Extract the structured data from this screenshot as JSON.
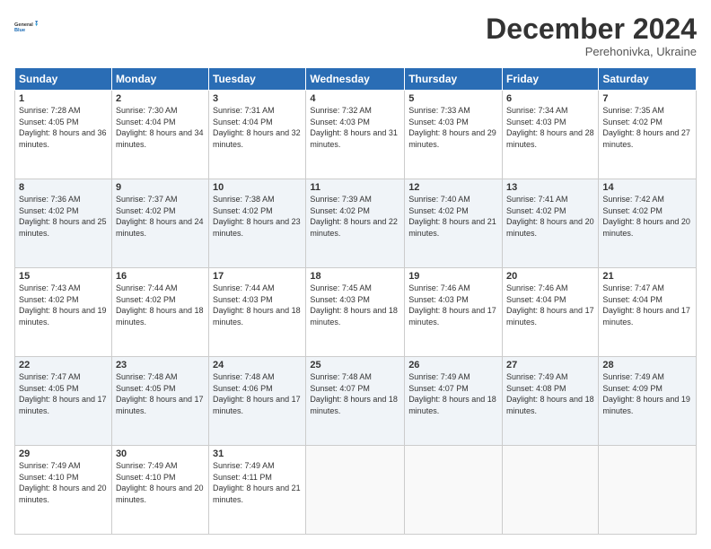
{
  "logo": {
    "line1": "General",
    "line2": "Blue"
  },
  "header": {
    "month": "December 2024",
    "location": "Perehonivka, Ukraine"
  },
  "weekdays": [
    "Sunday",
    "Monday",
    "Tuesday",
    "Wednesday",
    "Thursday",
    "Friday",
    "Saturday"
  ],
  "weeks": [
    [
      {
        "day": "1",
        "sunrise": "7:28 AM",
        "sunset": "4:05 PM",
        "daylight": "8 hours and 36 minutes."
      },
      {
        "day": "2",
        "sunrise": "7:30 AM",
        "sunset": "4:04 PM",
        "daylight": "8 hours and 34 minutes."
      },
      {
        "day": "3",
        "sunrise": "7:31 AM",
        "sunset": "4:04 PM",
        "daylight": "8 hours and 32 minutes."
      },
      {
        "day": "4",
        "sunrise": "7:32 AM",
        "sunset": "4:03 PM",
        "daylight": "8 hours and 31 minutes."
      },
      {
        "day": "5",
        "sunrise": "7:33 AM",
        "sunset": "4:03 PM",
        "daylight": "8 hours and 29 minutes."
      },
      {
        "day": "6",
        "sunrise": "7:34 AM",
        "sunset": "4:03 PM",
        "daylight": "8 hours and 28 minutes."
      },
      {
        "day": "7",
        "sunrise": "7:35 AM",
        "sunset": "4:02 PM",
        "daylight": "8 hours and 27 minutes."
      }
    ],
    [
      {
        "day": "8",
        "sunrise": "7:36 AM",
        "sunset": "4:02 PM",
        "daylight": "8 hours and 25 minutes."
      },
      {
        "day": "9",
        "sunrise": "7:37 AM",
        "sunset": "4:02 PM",
        "daylight": "8 hours and 24 minutes."
      },
      {
        "day": "10",
        "sunrise": "7:38 AM",
        "sunset": "4:02 PM",
        "daylight": "8 hours and 23 minutes."
      },
      {
        "day": "11",
        "sunrise": "7:39 AM",
        "sunset": "4:02 PM",
        "daylight": "8 hours and 22 minutes."
      },
      {
        "day": "12",
        "sunrise": "7:40 AM",
        "sunset": "4:02 PM",
        "daylight": "8 hours and 21 minutes."
      },
      {
        "day": "13",
        "sunrise": "7:41 AM",
        "sunset": "4:02 PM",
        "daylight": "8 hours and 20 minutes."
      },
      {
        "day": "14",
        "sunrise": "7:42 AM",
        "sunset": "4:02 PM",
        "daylight": "8 hours and 20 minutes."
      }
    ],
    [
      {
        "day": "15",
        "sunrise": "7:43 AM",
        "sunset": "4:02 PM",
        "daylight": "8 hours and 19 minutes."
      },
      {
        "day": "16",
        "sunrise": "7:44 AM",
        "sunset": "4:02 PM",
        "daylight": "8 hours and 18 minutes."
      },
      {
        "day": "17",
        "sunrise": "7:44 AM",
        "sunset": "4:03 PM",
        "daylight": "8 hours and 18 minutes."
      },
      {
        "day": "18",
        "sunrise": "7:45 AM",
        "sunset": "4:03 PM",
        "daylight": "8 hours and 18 minutes."
      },
      {
        "day": "19",
        "sunrise": "7:46 AM",
        "sunset": "4:03 PM",
        "daylight": "8 hours and 17 minutes."
      },
      {
        "day": "20",
        "sunrise": "7:46 AM",
        "sunset": "4:04 PM",
        "daylight": "8 hours and 17 minutes."
      },
      {
        "day": "21",
        "sunrise": "7:47 AM",
        "sunset": "4:04 PM",
        "daylight": "8 hours and 17 minutes."
      }
    ],
    [
      {
        "day": "22",
        "sunrise": "7:47 AM",
        "sunset": "4:05 PM",
        "daylight": "8 hours and 17 minutes."
      },
      {
        "day": "23",
        "sunrise": "7:48 AM",
        "sunset": "4:05 PM",
        "daylight": "8 hours and 17 minutes."
      },
      {
        "day": "24",
        "sunrise": "7:48 AM",
        "sunset": "4:06 PM",
        "daylight": "8 hours and 17 minutes."
      },
      {
        "day": "25",
        "sunrise": "7:48 AM",
        "sunset": "4:07 PM",
        "daylight": "8 hours and 18 minutes."
      },
      {
        "day": "26",
        "sunrise": "7:49 AM",
        "sunset": "4:07 PM",
        "daylight": "8 hours and 18 minutes."
      },
      {
        "day": "27",
        "sunrise": "7:49 AM",
        "sunset": "4:08 PM",
        "daylight": "8 hours and 18 minutes."
      },
      {
        "day": "28",
        "sunrise": "7:49 AM",
        "sunset": "4:09 PM",
        "daylight": "8 hours and 19 minutes."
      }
    ],
    [
      {
        "day": "29",
        "sunrise": "7:49 AM",
        "sunset": "4:10 PM",
        "daylight": "8 hours and 20 minutes."
      },
      {
        "day": "30",
        "sunrise": "7:49 AM",
        "sunset": "4:10 PM",
        "daylight": "8 hours and 20 minutes."
      },
      {
        "day": "31",
        "sunrise": "7:49 AM",
        "sunset": "4:11 PM",
        "daylight": "8 hours and 21 minutes."
      },
      null,
      null,
      null,
      null
    ]
  ],
  "labels": {
    "sunrise": "Sunrise:",
    "sunset": "Sunset:",
    "daylight": "Daylight:"
  }
}
